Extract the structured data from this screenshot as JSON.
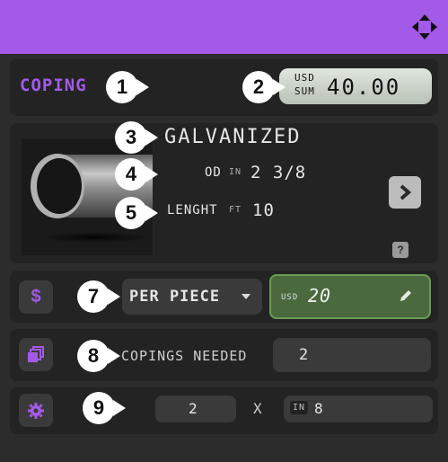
{
  "coping": {
    "label": "COPING"
  },
  "price_sum": {
    "currency": "USD",
    "sum_label": "SUM",
    "value": "40.00"
  },
  "material": {
    "name": "GALVANIZED"
  },
  "dimensions": {
    "od_label": "OD",
    "od_unit": "IN",
    "od_value": "2 3/8",
    "length_label": "LENGHT",
    "length_unit": "FT",
    "length_value": "10"
  },
  "pricing": {
    "mode": "PER PIECE",
    "currency": "USD",
    "price": "20"
  },
  "copings_needed": {
    "label": "COPINGS NEEDED",
    "value": "2"
  },
  "config": {
    "count": "2",
    "times": "X",
    "unit": "IN",
    "size": "8"
  },
  "markers": [
    "1",
    "2",
    "3",
    "4",
    "5",
    "7",
    "8",
    "9"
  ],
  "help": {
    "label": "?"
  },
  "colors": {
    "accent": "#a35ae8",
    "green_field": "#4a6a3d"
  }
}
